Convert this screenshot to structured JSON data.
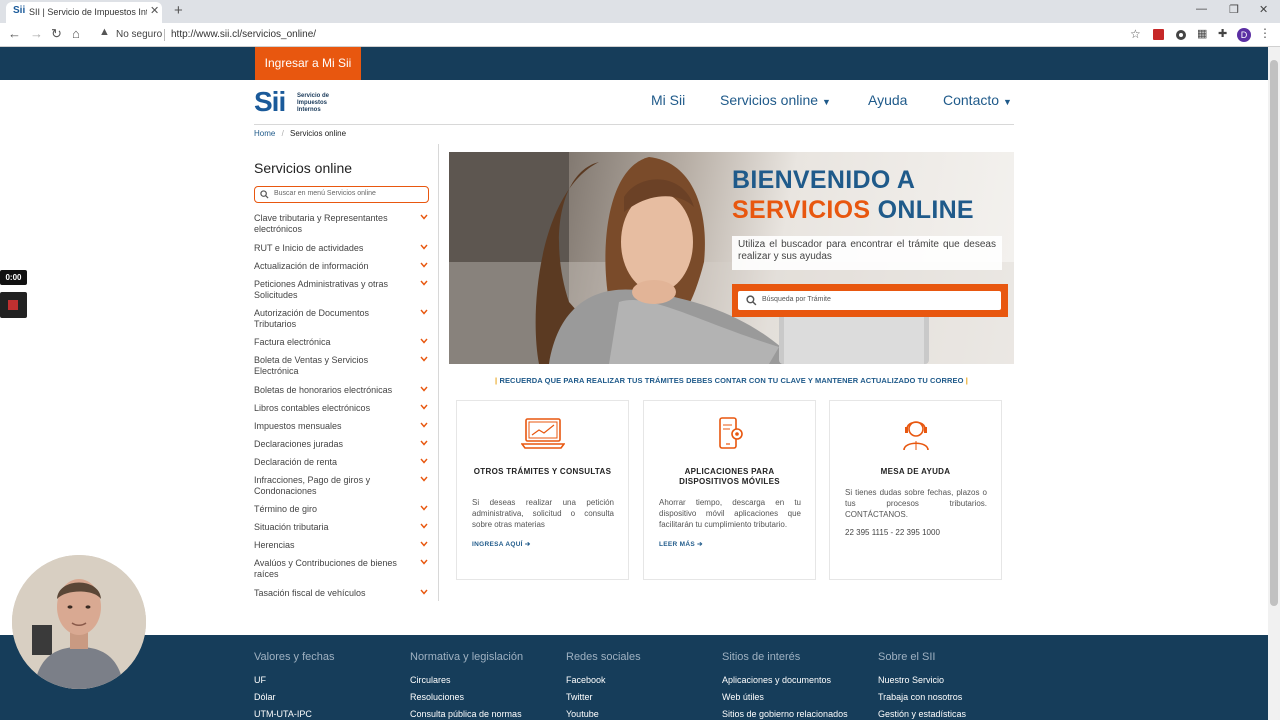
{
  "browser": {
    "tab_title": "SII | Servicio de Impuestos Intern",
    "tab_favicon": "Sii",
    "new_tab_label": "+",
    "security_label": "No seguro",
    "url": "http://www.sii.cl/servicios_online/",
    "profile_initial": "D"
  },
  "topbar": {
    "ingresar": "Ingresar a Mi Sii"
  },
  "header": {
    "logo_text": "Sii",
    "logo_subtext": "Servicio de Impuestos Internos",
    "nav": [
      "Mi Sii",
      "Servicios online",
      "Ayuda",
      "Contacto"
    ]
  },
  "breadcrumb": {
    "home": "Home",
    "current": "Servicios online"
  },
  "sidebar": {
    "title": "Servicios online",
    "search_placeholder": "Buscar en menú Servicios online",
    "items": [
      "Clave tributaria y Representantes electrónicos",
      "RUT e Inicio de actividades",
      "Actualización de información",
      "Peticiones Administrativas y otras Solicitudes",
      "Autorización de Documentos Tributarios",
      "Factura electrónica",
      "Boleta de Ventas y Servicios Electrónica",
      "Boletas de honorarios electrónicas",
      "Libros contables electrónicos",
      "Impuestos mensuales",
      "Declaraciones juradas",
      "Declaración de renta",
      "Infracciones, Pago de giros y Condonaciones",
      "Término de giro",
      "Situación tributaria",
      "Herencias",
      "Avalúos y Contribuciones de bienes raíces",
      "Tasación fiscal de vehículos"
    ]
  },
  "hero": {
    "title_line1": "BIENVENIDO A",
    "title_line2_a": "SERVICIOS",
    "title_line2_b": "ONLINE",
    "subtitle": "Utiliza el buscador para encontrar el trámite que deseas realizar y sus ayudas",
    "search_placeholder": "Búsqueda por Trámite"
  },
  "notice": "RECUERDA QUE PARA REALIZAR TUS TRÁMITES DEBES CONTAR CON TU CLAVE Y MANTENER ACTUALIZADO TU CORREO",
  "cards": [
    {
      "icon": "laptop-chart-icon",
      "title": "OTROS TRÁMITES Y CONSULTAS",
      "text": "Si deseas realizar una petición administrativa, solicitud o consulta sobre otras materias",
      "link": "INGRESA AQUÍ"
    },
    {
      "icon": "mobile-gear-icon",
      "title": "APLICACIONES PARA DISPOSITIVOS MÓVILES",
      "text": "Ahorrar tiempo, descarga en tu dispositivo móvil aplicaciones que facilitarán tu cumplimiento tributario.",
      "link": "LEER MÁS"
    },
    {
      "icon": "headset-agent-icon",
      "title": "MESA DE AYUDA",
      "text": "Si tienes dudas sobre fechas, plazos o tus procesos tributarios. CONTÁCTANOS.",
      "phone": "22 395 1115 - 22 395 1000"
    }
  ],
  "footer": {
    "columns": [
      {
        "title": "Valores y fechas",
        "links": [
          "UF",
          "Dólar",
          "UTM-UTA-IPC"
        ]
      },
      {
        "title": "Normativa y legislación",
        "links": [
          "Circulares",
          "Resoluciones",
          "Consulta pública de normas"
        ]
      },
      {
        "title": "Redes sociales",
        "links": [
          "Facebook",
          "Twitter",
          "Youtube"
        ]
      },
      {
        "title": "Sitios de interés",
        "links": [
          "Aplicaciones y documentos",
          "Web útiles",
          "Sitios de gobierno relacionados"
        ]
      },
      {
        "title": "Sobre el SII",
        "links": [
          "Nuestro Servicio",
          "Trabaja con nosotros",
          "Gestión y estadísticas"
        ]
      }
    ]
  },
  "recorder": {
    "time": "0:00"
  },
  "colors": {
    "brand_blue": "#1f5a8a",
    "brand_orange": "#e8570f",
    "dark_navy": "#163d5a"
  }
}
